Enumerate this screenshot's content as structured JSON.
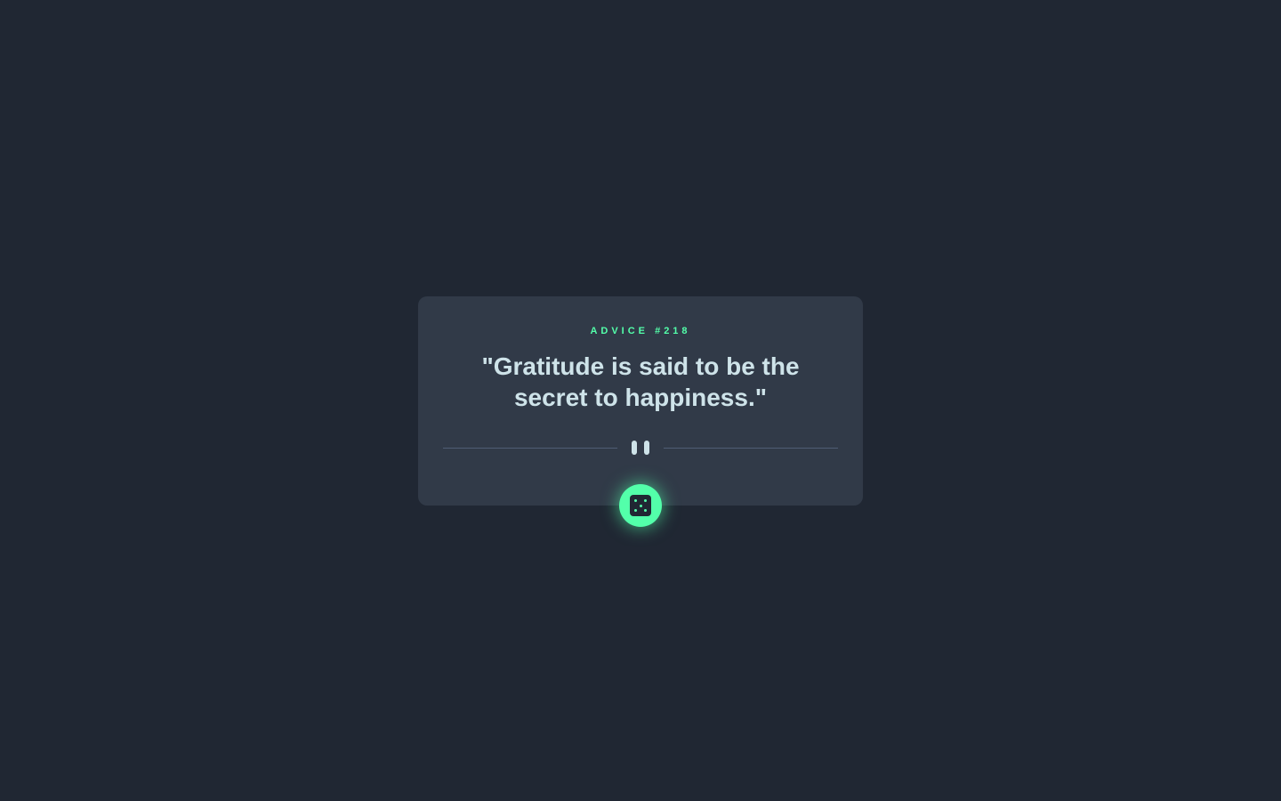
{
  "card": {
    "advice_label": "ADVICE #218",
    "quote": "\"Gratitude is said to be the secret to happiness.\""
  },
  "icons": {
    "divider": "pause-icon",
    "button": "dice-icon"
  },
  "colors": {
    "background": "#202733",
    "card": "#313A48",
    "accent": "#53FFAA",
    "text": "#CEE3E9",
    "divider": "#4F5D74"
  }
}
